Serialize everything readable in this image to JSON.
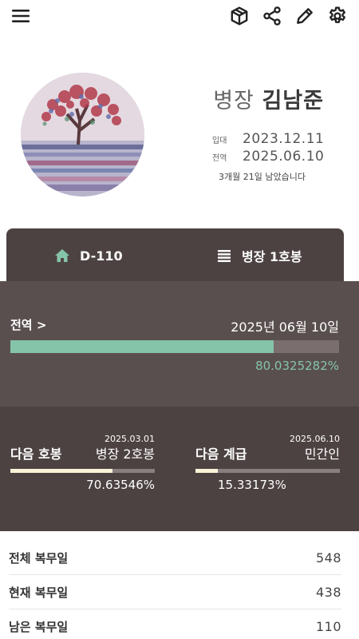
{
  "toolbar": {
    "icons": [
      "menu-icon",
      "cube-icon",
      "share-icon",
      "pencil-icon",
      "gear-icon"
    ]
  },
  "profile": {
    "rank": "병장",
    "name": "김남준",
    "enlist_label": "입대",
    "enlist_date": "2023.12.11",
    "discharge_label": "전역",
    "discharge_date": "2025.06.10",
    "remaining_text": "3개월 21일 남았습니다"
  },
  "tabs": {
    "dday": "D-110",
    "rank_step": "병장 1호봉"
  },
  "discharge": {
    "label": "전역 >",
    "date": "2025년 06월 10일",
    "percent_text": "80.0325282%",
    "progress": 0.800325282
  },
  "next_step": {
    "title": "다음 호봉",
    "date": "2025.03.01",
    "target": "병장 2호봉",
    "percent_text": "70.63546%",
    "progress": 0.7063546
  },
  "next_rank": {
    "title": "다음 계급",
    "date": "2025.06.10",
    "target": "민간인",
    "percent_text": "15.33173%",
    "progress": 0.1533173
  },
  "stats": [
    {
      "label": "전체 복무일",
      "value": "548"
    },
    {
      "label": "현재 복무일",
      "value": "438"
    },
    {
      "label": "남은 복무일",
      "value": "110"
    }
  ],
  "colors": {
    "dark_panel": "#4d4242",
    "mid_panel": "#5a4f4f",
    "accent_green": "#85c4a8",
    "accent_cream": "#fbf3d8"
  }
}
